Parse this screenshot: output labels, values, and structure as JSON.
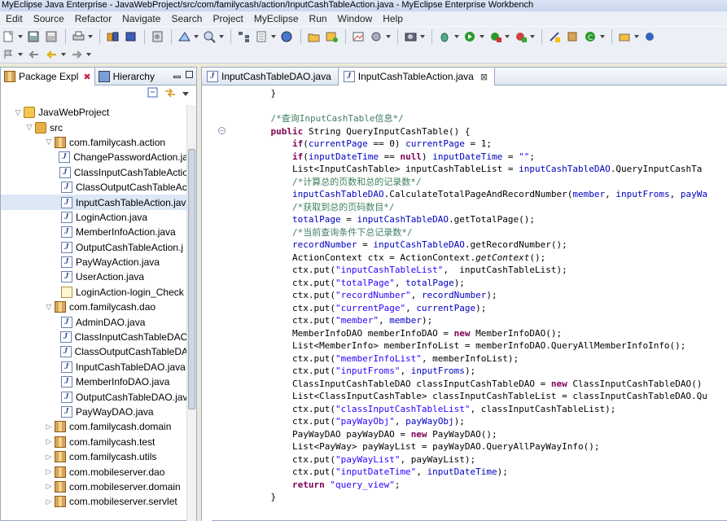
{
  "window": {
    "title": "MyEclipse Java Enterprise - JavaWebProject/src/com/familycash/action/InputCashTableAction.java - MyEclipse Enterprise Workbench"
  },
  "menu": [
    "Edit",
    "Source",
    "Refactor",
    "Navigate",
    "Search",
    "Project",
    "MyEclipse",
    "Run",
    "Window",
    "Help"
  ],
  "left_tabs": {
    "package_explorer": "Package Expl",
    "hierarchy": "Hierarchy"
  },
  "tree": [
    {
      "label": "JavaWebProject",
      "icon": "project-icon",
      "level": 1,
      "twisty": "▽"
    },
    {
      "label": "src",
      "icon": "source-folder-icon",
      "level": 2,
      "twisty": "▽"
    },
    {
      "label": "com.familycash.action",
      "icon": "package-icon",
      "level": 3,
      "twisty": "▽"
    },
    {
      "label": "ChangePasswordAction.ja",
      "icon": "java-file-icon",
      "level": 4
    },
    {
      "label": "ClassInputCashTableActio",
      "icon": "java-file-icon",
      "level": 4
    },
    {
      "label": "ClassOutputCashTableAc",
      "icon": "java-file-icon",
      "level": 4
    },
    {
      "label": "InputCashTableAction.jav",
      "icon": "java-file-icon",
      "level": 4,
      "selected": true
    },
    {
      "label": "LoginAction.java",
      "icon": "java-file-icon",
      "level": 4
    },
    {
      "label": "MemberInfoAction.java",
      "icon": "java-file-icon",
      "level": 4
    },
    {
      "label": "OutputCashTableAction.j",
      "icon": "java-file-icon",
      "level": 4
    },
    {
      "label": "PayWayAction.java",
      "icon": "java-file-icon",
      "level": 4
    },
    {
      "label": "UserAction.java",
      "icon": "java-file-icon",
      "level": 4
    },
    {
      "label": "LoginAction-login_Check",
      "icon": "xml-file-icon",
      "level": 4
    },
    {
      "label": "com.familycash.dao",
      "icon": "package-icon",
      "level": 3,
      "twisty": "▽"
    },
    {
      "label": "AdminDAO.java",
      "icon": "java-file-icon",
      "level": 4
    },
    {
      "label": "ClassInputCashTableDAO",
      "icon": "java-file-icon",
      "level": 4
    },
    {
      "label": "ClassOutputCashTableDA",
      "icon": "java-file-icon",
      "level": 4
    },
    {
      "label": "InputCashTableDAO.java",
      "icon": "java-file-icon",
      "level": 4
    },
    {
      "label": "MemberInfoDAO.java",
      "icon": "java-file-icon",
      "level": 4
    },
    {
      "label": "OutputCashTableDAO.jav",
      "icon": "java-file-icon",
      "level": 4
    },
    {
      "label": "PayWayDAO.java",
      "icon": "java-file-icon",
      "level": 4
    },
    {
      "label": "com.familycash.domain",
      "icon": "package-icon",
      "level": 3,
      "twisty": "▷"
    },
    {
      "label": "com.familycash.test",
      "icon": "package-icon",
      "level": 3,
      "twisty": "▷"
    },
    {
      "label": "com.familycash.utils",
      "icon": "package-icon",
      "level": 3,
      "twisty": "▷"
    },
    {
      "label": "com.mobileserver.dao",
      "icon": "package-icon",
      "level": 3,
      "twisty": "▷"
    },
    {
      "label": "com.mobileserver.domain",
      "icon": "package-icon",
      "level": 3,
      "twisty": "▷"
    },
    {
      "label": "com.mobileserver.servlet",
      "icon": "package-icon",
      "level": 3,
      "twisty": "▷"
    }
  ],
  "editor_tabs": [
    {
      "label": "InputCashTableDAO.java",
      "active": false
    },
    {
      "label": "InputCashTableAction.java",
      "active": true,
      "close": "⊠"
    }
  ],
  "code_lines": [
    "    }",
    "",
    "    /*查询InputCashTable信息*/",
    "    public String QueryInputCashTable() {",
    "        if(currentPage == 0) currentPage = 1;",
    "        if(inputDateTime == null) inputDateTime = \"\";",
    "        List<InputCashTable> inputCashTableList = inputCashTableDAO.QueryInputCashTa",
    "        /*计算总的页数和总的记录数*/",
    "        inputCashTableDAO.CalculateTotalPageAndRecordNumber(member, inputFroms, payWa",
    "        /*获取到总的页码数目*/",
    "        totalPage = inputCashTableDAO.getTotalPage();",
    "        /*当前查询条件下总记录数*/",
    "        recordNumber = inputCashTableDAO.getRecordNumber();",
    "        ActionContext ctx = ActionContext.getContext();",
    "        ctx.put(\"inputCashTableList\",  inputCashTableList);",
    "        ctx.put(\"totalPage\", totalPage);",
    "        ctx.put(\"recordNumber\", recordNumber);",
    "        ctx.put(\"currentPage\", currentPage);",
    "        ctx.put(\"member\", member);",
    "        MemberInfoDAO memberInfoDAO = new MemberInfoDAO();",
    "        List<MemberInfo> memberInfoList = memberInfoDAO.QueryAllMemberInfoInfo();",
    "        ctx.put(\"memberInfoList\", memberInfoList);",
    "        ctx.put(\"inputFroms\", inputFroms);",
    "        ClassInputCashTableDAO classInputCashTableDAO = new ClassInputCashTableDAO()",
    "        List<ClassInputCashTable> classInputCashTableList = classInputCashTableDAO.Qu",
    "        ctx.put(\"classInputCashTableList\", classInputCashTableList);",
    "        ctx.put(\"payWayObj\", payWayObj);",
    "        PayWayDAO payWayDAO = new PayWayDAO();",
    "        List<PayWay> payWayList = payWayDAO.QueryAllPayWayInfo();",
    "        ctx.put(\"payWayList\", payWayList);",
    "        ctx.put(\"inputDateTime\", inputDateTime);",
    "        return \"query_view\";",
    "    }"
  ],
  "colors": {
    "keyword": "#7f0055",
    "string": "#2a00ff",
    "comment": "#3f7f5f",
    "field": "#0000c0"
  }
}
